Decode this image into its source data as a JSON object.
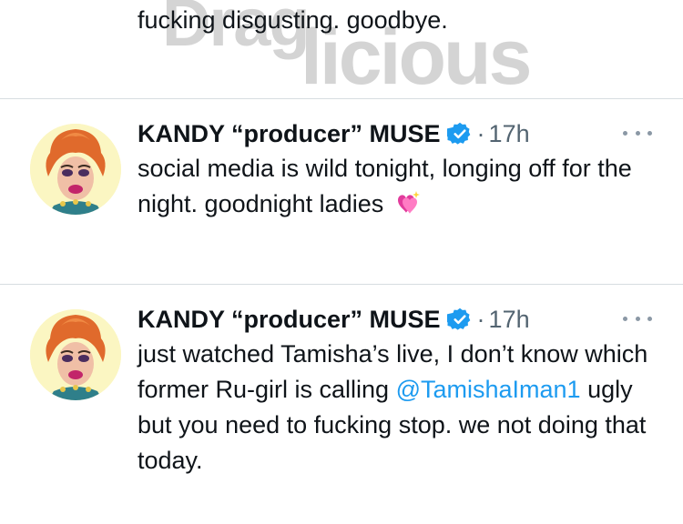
{
  "watermark": {
    "line1": "Drag",
    "line2": "licious"
  },
  "top_tweet": {
    "text": "fucking disgusting. goodbye."
  },
  "tweets": [
    {
      "name": "KANDY “producer” MUSE",
      "separator": "·",
      "time": "17h",
      "text": "social media is wild tonight, longing off for the night. goodnight ladies",
      "emoji": "sparkling-heart-emoji"
    },
    {
      "name": "KANDY “producer” MUSE",
      "separator": "·",
      "time": "17h",
      "text_before": "just watched Tamisha’s live, I don’t know which former Ru-girl is calling ",
      "mention": "@TamishaIman1",
      "text_after": " ugly but you need to fucking stop. we not doing that today."
    }
  ],
  "colors": {
    "text": "#0f1419",
    "secondary": "#536471",
    "link": "#1d9bf0",
    "verified": "#1d9bf0",
    "divider": "#d7dde1"
  }
}
